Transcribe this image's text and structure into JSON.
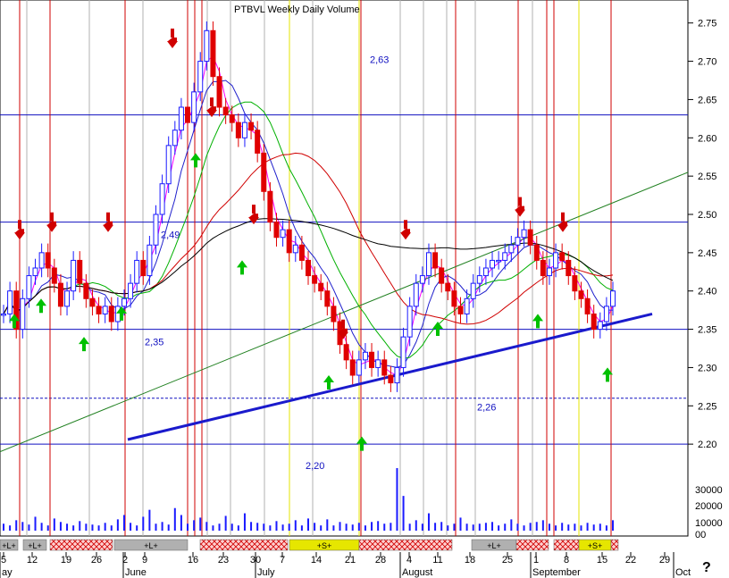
{
  "header": {
    "title": "PTBVL Weekly Daily Volume"
  },
  "chart_data": {
    "type": "candlestick",
    "title": "PTBVL",
    "ylim": [
      2.15,
      2.78
    ],
    "y_ticks": [
      "2.75",
      "2.70",
      "2.65",
      "2.60",
      "2.55",
      "2.50",
      "2.45",
      "2.40",
      "2.35",
      "2.30",
      "2.25",
      "2.20"
    ],
    "volume_ticks": [
      "30000",
      "20000",
      "10000",
      "00"
    ],
    "x_month_labels": [
      "ay",
      "June",
      "July",
      "August",
      "September",
      "Oct"
    ],
    "x_day_labels": [
      "5",
      "12",
      "19",
      "26",
      "2",
      "9",
      "16",
      "23",
      "30",
      "7",
      "14",
      "21",
      "28",
      "4",
      "11",
      "18",
      "25",
      "1",
      "8",
      "15",
      "22",
      "29"
    ],
    "level_labels": [
      {
        "value": 2.63,
        "text": "2,63"
      },
      {
        "value": 2.49,
        "text": "2,49"
      },
      {
        "value": 2.35,
        "text": "2,35"
      },
      {
        "value": 2.26,
        "text": "2,26"
      },
      {
        "value": 2.2,
        "text": "2,20"
      }
    ],
    "signal_labels": [
      "+L+",
      "+L+",
      "+L+",
      "+S+",
      "+L+",
      "+S+"
    ],
    "closes": [
      2.37,
      2.4,
      2.35,
      2.39,
      2.42,
      2.43,
      2.45,
      2.43,
      2.41,
      2.38,
      2.4,
      2.44,
      2.41,
      2.39,
      2.38,
      2.37,
      2.38,
      2.36,
      2.38,
      2.39,
      2.41,
      2.44,
      2.42,
      2.46,
      2.5,
      2.54,
      2.59,
      2.61,
      2.64,
      2.62,
      2.66,
      2.7,
      2.74,
      2.68,
      2.64,
      2.63,
      2.62,
      2.6,
      2.62,
      2.61,
      2.58,
      2.53,
      2.49,
      2.47,
      2.48,
      2.45,
      2.46,
      2.44,
      2.42,
      2.41,
      2.4,
      2.38,
      2.36,
      2.33,
      2.31,
      2.29,
      2.31,
      2.32,
      2.3,
      2.31,
      2.29,
      2.28,
      2.3,
      2.34,
      2.38,
      2.41,
      2.42,
      2.45,
      2.43,
      2.41,
      2.4,
      2.38,
      2.37,
      2.39,
      2.41,
      2.42,
      2.43,
      2.44,
      2.44,
      2.45,
      2.46,
      2.47,
      2.48,
      2.46,
      2.44,
      2.42,
      2.43,
      2.45,
      2.44,
      2.42,
      2.4,
      2.39,
      2.37,
      2.35,
      2.36,
      2.38,
      2.4
    ],
    "volumes": [
      4000,
      3000,
      6000,
      5000,
      3500,
      8000,
      4500,
      3000,
      7000,
      5000,
      4000,
      3000,
      5500,
      4000,
      3500,
      3000,
      4500,
      3000,
      6500,
      9000,
      4500,
      3000,
      8000,
      12000,
      4000,
      5000,
      3500,
      13000,
      9000,
      4000,
      6000,
      7500,
      5000,
      3000,
      4000,
      8500,
      4000,
      3000,
      10000,
      5000,
      4500,
      4000,
      3000,
      5500,
      3500,
      4000,
      6000,
      3000,
      7000,
      4500,
      3000,
      6500,
      3000,
      5000,
      4000,
      3500,
      4500,
      3000,
      5000,
      5500,
      4000,
      4500,
      36000,
      20000,
      4000,
      6000,
      4000,
      10000,
      4500,
      5000,
      3000,
      4000,
      7500,
      4000,
      3500,
      4000,
      4500,
      5000,
      3000,
      4000,
      6500,
      4000,
      3000,
      4500,
      5000,
      6000,
      4000,
      3000,
      4500,
      3500,
      4000,
      3000,
      4500,
      3500,
      4000,
      3000,
      6000
    ],
    "colors": {
      "price_up": "#1a1aff",
      "price_down": "#e00000",
      "ma_fast": "#ff00ff",
      "ma_blue": "#2020cc",
      "ma_green": "#00b000",
      "ma_red": "#d00000",
      "ma_black": "#000000",
      "level_line": "#1010c0",
      "signal_red": "#d00000",
      "signal_yellow": "#e6e600",
      "trend_blue": "#1a1acc",
      "trend_green": "#208020"
    }
  }
}
